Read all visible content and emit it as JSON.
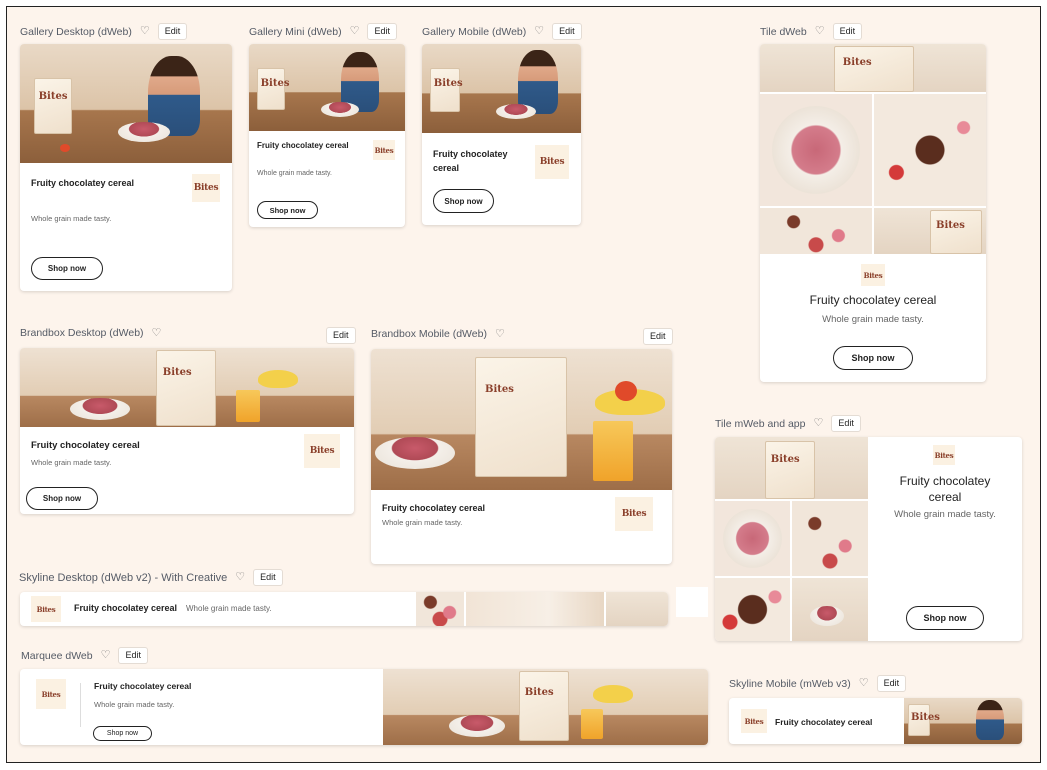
{
  "common": {
    "title": "Fruity chocolatey cereal",
    "subtitle": "Whole grain made tasty.",
    "cta": "Shop now",
    "edit": "Edit",
    "heart": "♡",
    "logo": "Bites"
  },
  "sections": {
    "gallery_desktop": "Gallery Desktop (dWeb)",
    "gallery_mini": "Gallery Mini (dWeb)",
    "gallery_mobile": "Gallery Mobile (dWeb)",
    "tile_dweb": "Tile dWeb",
    "brandbox_desktop": "Brandbox Desktop (dWeb)",
    "brandbox_mobile": "Brandbox Mobile (dWeb)",
    "tile_mweb": "Tile mWeb and app",
    "skyline_desktop": "Skyline Desktop (dWeb v2) - With Creative",
    "marquee": "Marquee dWeb",
    "skyline_mobile": "Skyline Mobile (mWeb v3)"
  },
  "tile_mweb_title": "Fruity chocolatey\ncereal"
}
